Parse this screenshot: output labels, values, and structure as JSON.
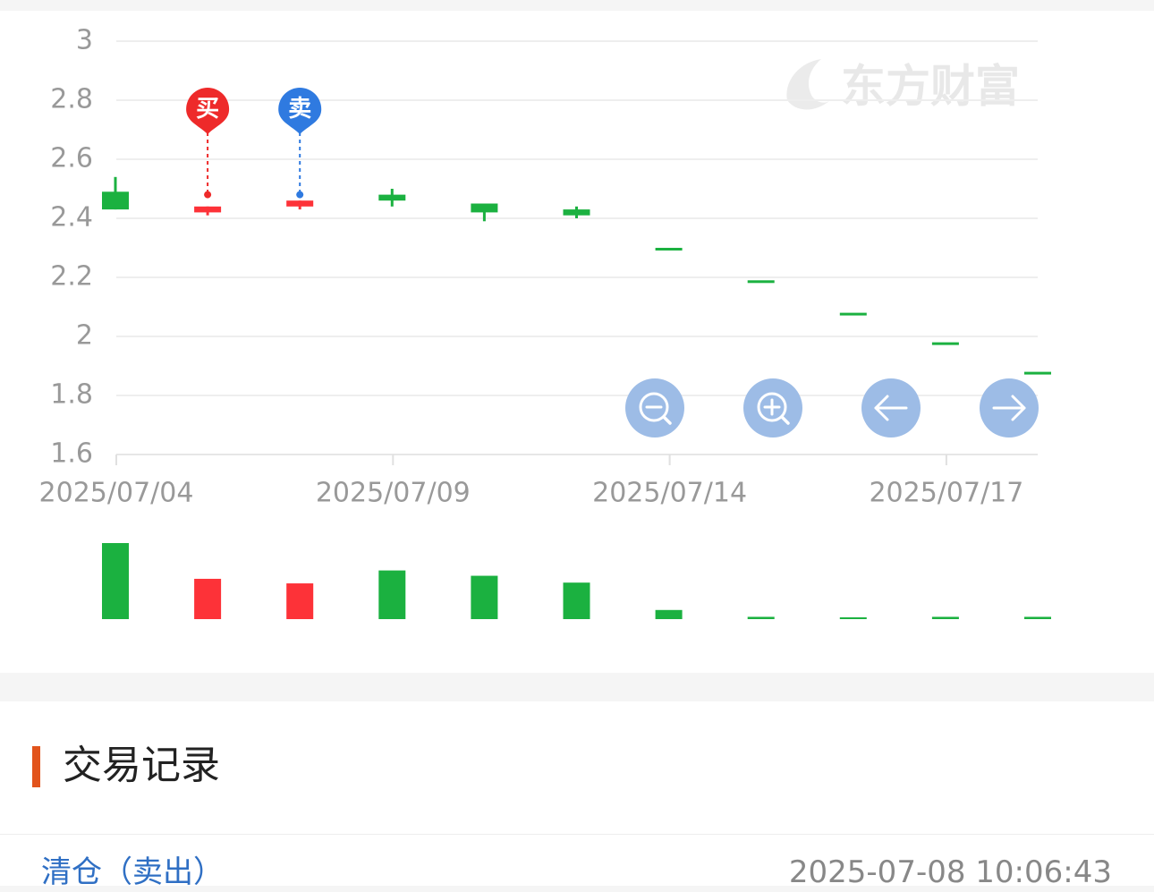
{
  "watermark": {
    "text": "东方财富"
  },
  "markers": {
    "buy": "买",
    "sell": "卖"
  },
  "controls": {
    "zoom_out": "zoom-out-icon",
    "zoom_in": "zoom-in-icon",
    "prev": "arrow-left-icon",
    "next": "arrow-right-icon"
  },
  "colors": {
    "up": "#fd3238",
    "down": "#1bb140",
    "buy_marker": "#ee2a2a",
    "sell_marker": "#2f7ae0",
    "accent": "#e2541c",
    "link": "#2f6fc4"
  },
  "chart_data": {
    "type": "candlestick",
    "y_ticks": [
      "3",
      "2.8",
      "2.6",
      "2.4",
      "2.2",
      "2",
      "1.8",
      "1.6"
    ],
    "ylim": [
      1.6,
      3.0
    ],
    "x_tick_labels": [
      {
        "label": "2025/07/04",
        "index": 0
      },
      {
        "label": "2025/07/09",
        "index": 3
      },
      {
        "label": "2025/07/14",
        "index": 6
      },
      {
        "label": "2025/07/17",
        "index": 9
      }
    ],
    "grid": true,
    "candles": [
      {
        "open": 2.49,
        "close": 2.43,
        "high": 2.54,
        "low": 2.43,
        "dir": "down",
        "volume": 1.0
      },
      {
        "open": 2.42,
        "close": 2.44,
        "high": 2.44,
        "low": 2.41,
        "dir": "up",
        "volume": 0.53
      },
      {
        "open": 2.44,
        "close": 2.46,
        "high": 2.46,
        "low": 2.43,
        "dir": "up",
        "volume": 0.47
      },
      {
        "open": 2.48,
        "close": 2.46,
        "high": 2.5,
        "low": 2.44,
        "dir": "down",
        "volume": 0.64
      },
      {
        "open": 2.45,
        "close": 2.42,
        "high": 2.45,
        "low": 2.39,
        "dir": "down",
        "volume": 0.57
      },
      {
        "open": 2.43,
        "close": 2.41,
        "high": 2.44,
        "low": 2.4,
        "dir": "down",
        "volume": 0.48
      },
      {
        "open": 2.3,
        "close": 2.3,
        "high": 2.3,
        "low": 2.3,
        "dir": "down",
        "volume": 0.12
      },
      {
        "open": 2.19,
        "close": 2.19,
        "high": 2.19,
        "low": 2.19,
        "dir": "down",
        "volume": 0.03
      },
      {
        "open": 2.08,
        "close": 2.08,
        "high": 2.08,
        "low": 2.08,
        "dir": "down",
        "volume": 0.02
      },
      {
        "open": 1.98,
        "close": 1.98,
        "high": 1.98,
        "low": 1.98,
        "dir": "down",
        "volume": 0.03
      },
      {
        "open": 1.88,
        "close": 1.88,
        "high": 1.88,
        "low": 1.88,
        "dir": "down",
        "volume": 0.03
      }
    ],
    "trades": [
      {
        "type": "buy",
        "index": 1,
        "price": 2.48
      },
      {
        "type": "sell",
        "index": 2,
        "price": 2.48
      }
    ]
  },
  "records": {
    "title": "交易记录",
    "rows": [
      {
        "action": "清仓（卖出）",
        "time": "2025-07-08 10:06:43"
      }
    ]
  }
}
